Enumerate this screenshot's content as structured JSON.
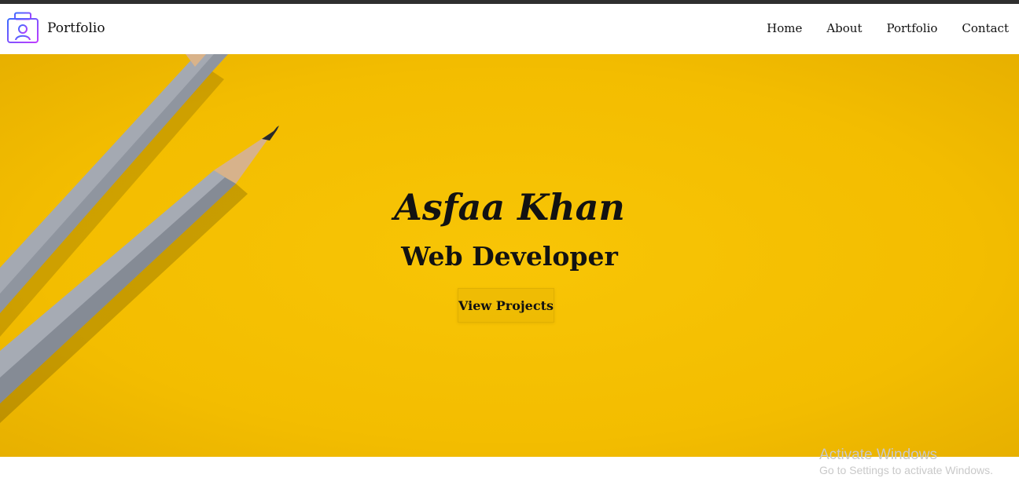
{
  "brand": {
    "name": "Portfolio",
    "icon": "portfolio-briefcase-icon"
  },
  "nav": {
    "items": [
      {
        "label": "Home"
      },
      {
        "label": "About"
      },
      {
        "label": "Portfolio"
      },
      {
        "label": "Contact"
      }
    ]
  },
  "hero": {
    "name": "Asfaa Khan",
    "role": "Web Developer",
    "cta_label": "View Projects",
    "background_color": "#f3bd00"
  },
  "watermark": {
    "title": "Activate Windows",
    "subtitle": "Go to Settings to activate Windows."
  }
}
